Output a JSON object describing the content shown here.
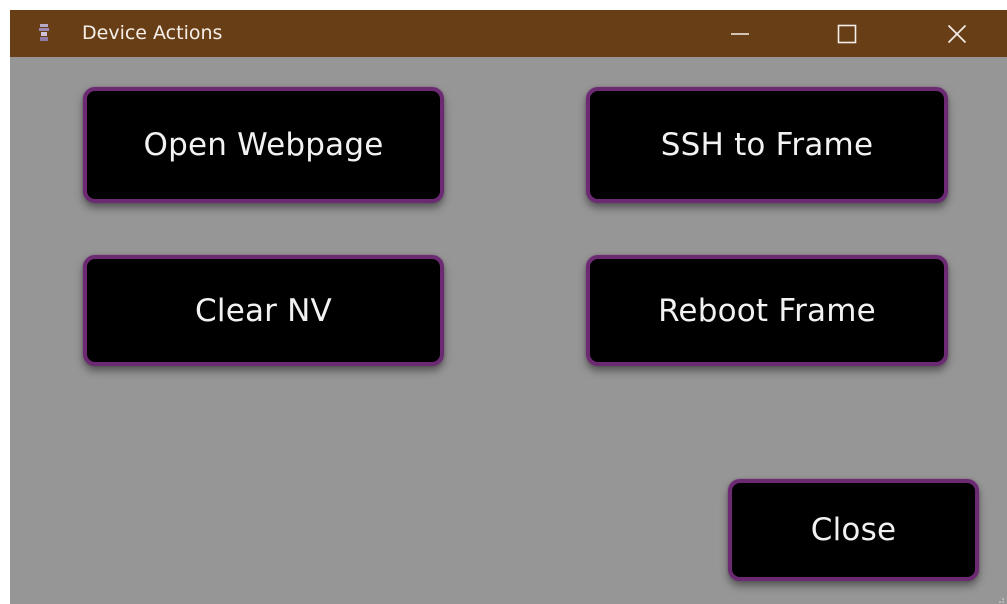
{
  "window": {
    "title": "Device Actions",
    "icon": "app-icon",
    "controls": {
      "minimize_icon": "minimize-icon",
      "maximize_icon": "maximize-icon",
      "close_icon": "close-icon"
    }
  },
  "actions": {
    "open_webpage": "Open Webpage",
    "ssh_to_frame": "SSH to Frame",
    "clear_nv": "Clear NV",
    "reboot_frame": "Reboot Frame",
    "close": "Close"
  },
  "colors": {
    "titlebar": "#683e17",
    "window_background": "#969696",
    "button_background": "#000000",
    "button_border": "#6b2a72",
    "button_text": "#f2f2f2"
  }
}
